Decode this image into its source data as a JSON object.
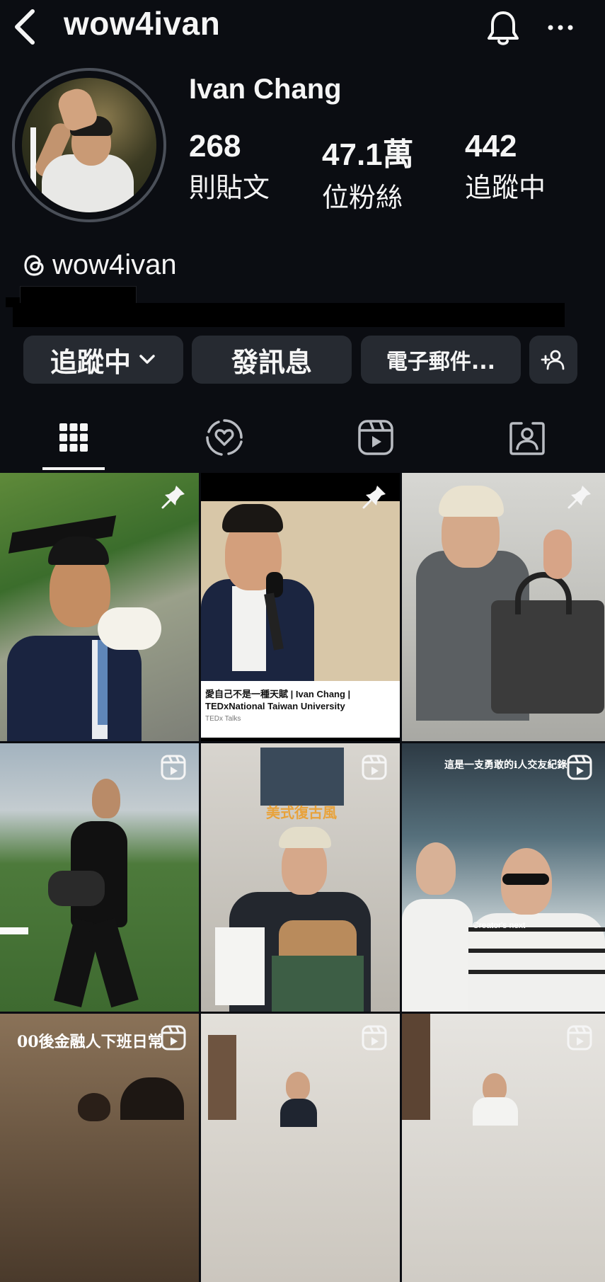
{
  "header": {
    "username": "wow4ivan",
    "back_icon": "chevron-left-icon",
    "notifications_icon": "bell-icon",
    "more_icon": "more-horizontal-icon"
  },
  "profile": {
    "full_name": "Ivan Chang",
    "stats": [
      {
        "value": "268",
        "label": "則貼文"
      },
      {
        "value": "47.1萬",
        "label": "位粉絲"
      },
      {
        "value": "442",
        "label": "追蹤中"
      }
    ],
    "threads_handle": "wow4ivan"
  },
  "actions": {
    "following_label": "追蹤中",
    "message_label": "發訊息",
    "email_label": "電子郵件...",
    "suggest_icon": "add-person-icon"
  },
  "tabs": [
    {
      "name": "posts",
      "icon": "grid-icon",
      "active": true
    },
    {
      "name": "collabs",
      "icon": "collab-heart-icon",
      "active": false
    },
    {
      "name": "reels",
      "icon": "reels-icon",
      "active": false
    },
    {
      "name": "tagged",
      "icon": "tagged-person-icon",
      "active": false
    }
  ],
  "posts": [
    {
      "type": "pinned",
      "overlay": ""
    },
    {
      "type": "pinned",
      "overlay": "",
      "caption_title": "愛自己不是一種天賦 | Ivan Chang | TEDxNational Taiwan University",
      "caption_source": "TEDx Talks"
    },
    {
      "type": "pinned",
      "overlay": ""
    },
    {
      "type": "reel",
      "overlay": ""
    },
    {
      "type": "reel",
      "overlay": "美式復古風"
    },
    {
      "type": "reel",
      "overlay": "這是一支勇敢的i人交友紀錄",
      "overlay2": "Creator's next"
    },
    {
      "type": "reel",
      "overlay": "00後金融人下班日常"
    },
    {
      "type": "reel",
      "overlay": ""
    },
    {
      "type": "reel",
      "overlay": ""
    }
  ],
  "colors": {
    "background": "#0b0d12",
    "button_bg": "#262a31",
    "text": "#f5f5f5",
    "overlay_gold": "#e8a23a"
  }
}
